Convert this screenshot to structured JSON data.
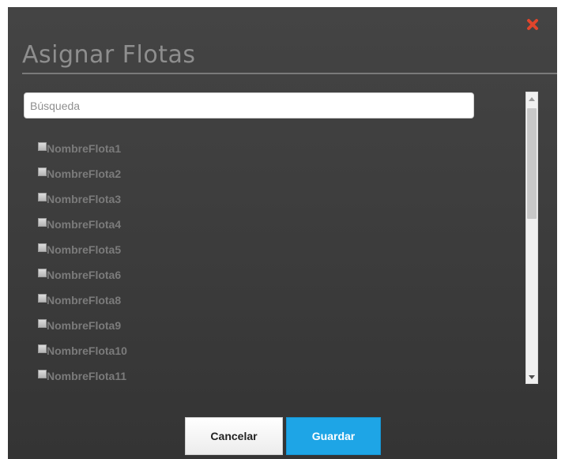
{
  "dialog": {
    "title": "Asignar Flotas"
  },
  "icons": {
    "close": "close-x-icon",
    "scroll_up": "arrow-up-icon",
    "scroll_down": "arrow-down-icon"
  },
  "colors": {
    "close_icon": "#e0452c",
    "save_button": "#1ea5e6",
    "dialog_background": "#3f3f3f"
  },
  "search": {
    "placeholder": "Búsqueda",
    "value": ""
  },
  "fleets": [
    {
      "label": "NombreFlota1",
      "checked": false
    },
    {
      "label": "NombreFlota2",
      "checked": false
    },
    {
      "label": "NombreFlota3",
      "checked": false
    },
    {
      "label": "NombreFlota4",
      "checked": false
    },
    {
      "label": "NombreFlota5",
      "checked": false
    },
    {
      "label": "NombreFlota6",
      "checked": false
    },
    {
      "label": "NombreFlota8",
      "checked": false
    },
    {
      "label": "NombreFlota9",
      "checked": false
    },
    {
      "label": "NombreFlota10",
      "checked": false
    },
    {
      "label": "NombreFlota11",
      "checked": false
    }
  ],
  "buttons": {
    "cancel_label": "Cancelar",
    "save_label": "Guardar"
  }
}
